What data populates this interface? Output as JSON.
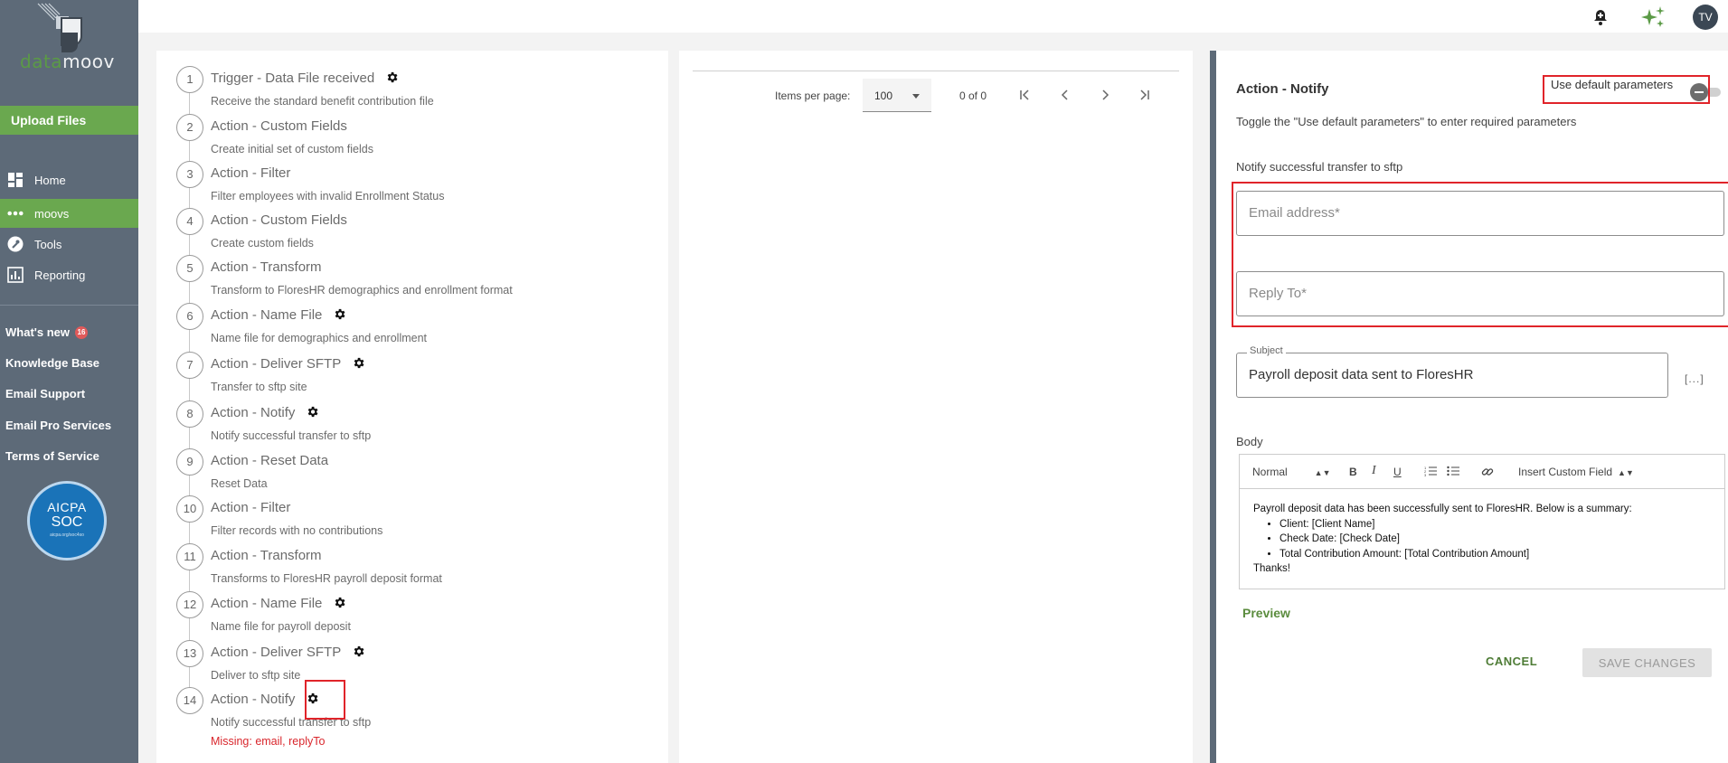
{
  "sidebar": {
    "logo_part1": "data",
    "logo_part2": "moov",
    "upload_label": "Upload Files",
    "nav": [
      {
        "label": "Home",
        "icon": "dashboard-icon"
      },
      {
        "label": "moovs",
        "icon": "dots-icon",
        "active": true
      },
      {
        "label": "Tools",
        "icon": "wrench-icon"
      },
      {
        "label": "Reporting",
        "icon": "chart-icon"
      }
    ],
    "links": [
      {
        "label": "What's new",
        "badge": "16"
      },
      {
        "label": "Knowledge Base"
      },
      {
        "label": "Email Support"
      },
      {
        "label": "Email Pro Services"
      },
      {
        "label": "Terms of Service"
      }
    ],
    "aicpa": {
      "line1": "AICPA",
      "line2": "SOC",
      "line3": "aicpa.org/soc4so"
    }
  },
  "topbar": {
    "avatar": "TV",
    "accent": "#5b9a46"
  },
  "steps": [
    {
      "num": "1",
      "title": "Trigger - Data File received",
      "desc": "Receive the standard benefit contribution file",
      "gear": true
    },
    {
      "num": "2",
      "title": "Action - Custom Fields",
      "desc": "Create initial set of custom fields",
      "gear": false
    },
    {
      "num": "3",
      "title": "Action - Filter",
      "desc": "Filter employees with invalid Enrollment Status",
      "gear": false
    },
    {
      "num": "4",
      "title": "Action - Custom Fields",
      "desc": "Create custom fields",
      "gear": false
    },
    {
      "num": "5",
      "title": "Action - Transform",
      "desc": "Transform to FloresHR demographics and enrollment format",
      "gear": false
    },
    {
      "num": "6",
      "title": "Action - Name File",
      "desc": "Name file for demographics and enrollment",
      "gear": true
    },
    {
      "num": "7",
      "title": "Action - Deliver SFTP",
      "desc": "Transfer to sftp site",
      "gear": true
    },
    {
      "num": "8",
      "title": "Action - Notify",
      "desc": "Notify successful transfer to sftp",
      "gear": true
    },
    {
      "num": "9",
      "title": "Action - Reset Data",
      "desc": "Reset Data",
      "gear": false
    },
    {
      "num": "10",
      "title": "Action - Filter",
      "desc": "Filter records with no contributions",
      "gear": false
    },
    {
      "num": "11",
      "title": "Action - Transform",
      "desc": "Transforms to FloresHR payroll deposit format",
      "gear": false
    },
    {
      "num": "12",
      "title": "Action - Name File",
      "desc": "Name file for payroll deposit",
      "gear": true
    },
    {
      "num": "13",
      "title": "Action - Deliver SFTP",
      "desc": "Deliver to sftp site",
      "gear": true
    },
    {
      "num": "14",
      "title": "Action - Notify",
      "desc": "Notify successful transfer to sftp",
      "gear": true
    }
  ],
  "missing_text": "Missing: email, replyTo",
  "pager": {
    "items_label": "Items per page:",
    "page_size": "100",
    "range": "0 of 0"
  },
  "panel": {
    "title": "Action - Notify",
    "default_label": "Use default parameters",
    "hint": "Toggle the \"Use default parameters\" to enter required parameters",
    "section": "Notify successful transfer to sftp",
    "email_placeholder": "Email address*",
    "reply_placeholder": "Reply To*",
    "subject_label": "Subject",
    "subject_value": "Payroll deposit data sent to FloresHR",
    "dots": "[...]",
    "body_label": "Body",
    "toolbar": {
      "format": "Normal",
      "bold": "B",
      "italic": "I",
      "underline": "U",
      "custom_field": "Insert Custom Field"
    },
    "body_text": {
      "intro": "Payroll deposit data has been successfully sent to FloresHR. Below is a summary:",
      "items": [
        "Client: [Client Name]",
        "Check Date: [Check Date]",
        "Total Contribution Amount: [Total Contribution Amount]"
      ],
      "outro": "Thanks!"
    },
    "preview": "Preview",
    "cancel": "CANCEL",
    "save": "SAVE CHANGES"
  }
}
